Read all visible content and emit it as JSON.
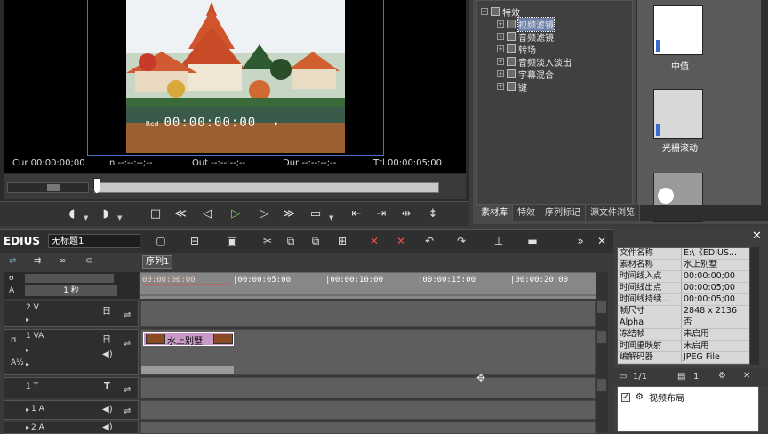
{
  "preview": {
    "overlay_rec": "Rcd",
    "overlay_tc": "00:00:00:00",
    "overlay_pause": "⏸",
    "cur": "Cur 00:00:00;00",
    "in": "In --:--:--;--",
    "out": "Out --:--:--;--",
    "dur": "Dur --:--:--;--",
    "ttl": "Ttl 00:00:05;00"
  },
  "effects": {
    "root": "特效",
    "items": [
      "视频滤镜",
      "音频滤镜",
      "转场",
      "音频淡入淡出",
      "字幕混合",
      "键"
    ],
    "thumbs": [
      "中值",
      "光栅滚动"
    ],
    "tabs": [
      "素材库",
      "特效",
      "序列标记",
      "源文件浏览"
    ]
  },
  "main": {
    "logo": "EDIUS",
    "project": "无标题1",
    "sequence_tab": "序列1",
    "zoom_label": "1 秒"
  },
  "ruler": [
    "00:00:00:00",
    "|00:00:05:00",
    "|00:00:10:00",
    "|00:00:15:00",
    "|00:00:20:00"
  ],
  "tracks": [
    {
      "name": "2 V"
    },
    {
      "name": "1 VA"
    },
    {
      "name": "1 T"
    },
    {
      "name": "1 A"
    },
    {
      "name": "2 A"
    }
  ],
  "clip": {
    "label": "水上别墅"
  },
  "info": {
    "rows": [
      {
        "k": "文件名称",
        "v": "E:\\《EDIUS..."
      },
      {
        "k": "素材名称",
        "v": "水上别墅"
      },
      {
        "k": "时间线入点",
        "v": "00:00:00;00"
      },
      {
        "k": "时间线出点",
        "v": "00:00:05;00"
      },
      {
        "k": "时间线持续...",
        "v": "00:00:05;00"
      },
      {
        "k": "帧尺寸",
        "v": "2848 x 2136"
      },
      {
        "k": "Alpha",
        "v": "否"
      },
      {
        "k": "冻结帧",
        "v": "未启用"
      },
      {
        "k": "时间重映射",
        "v": "未启用"
      },
      {
        "k": "编解码器",
        "v": "JPEG File"
      }
    ],
    "page": "1/1",
    "count": "1",
    "layout_item": "视频布局"
  },
  "colors": {
    "play": "#7cd860",
    "clip": "#c99ac8",
    "accent_frame": "#4a6fd0"
  }
}
